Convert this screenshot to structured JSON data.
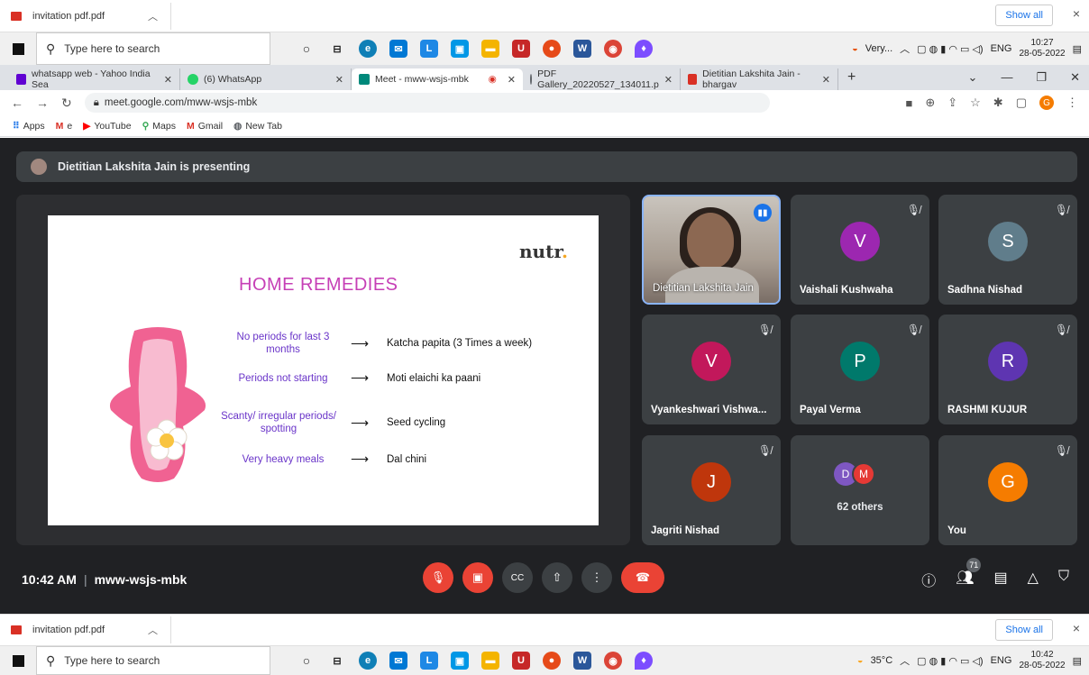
{
  "download_bar": {
    "file": "invitation pdf.pdf",
    "show_all": "Show all",
    "close": "×"
  },
  "taskbar_top": {
    "search_placeholder": "Type here to search",
    "weather": "Very...",
    "lang": "ENG",
    "time": "10:27",
    "date": "28-05-2022"
  },
  "tabs": [
    {
      "label": "whatsapp web - Yahoo India Sea",
      "color": "#6001d2"
    },
    {
      "label": "(6) WhatsApp",
      "color": "#25d366"
    },
    {
      "label": "Meet - mww-wsjs-mbk",
      "color": "#00897b"
    },
    {
      "label": "PDF Gallery_20220527_134011.p",
      "color": "#5f6368"
    },
    {
      "label": "Dietitian Lakshita Jain - bhargav",
      "color": "#d93025"
    }
  ],
  "address": {
    "url": "meet.google.com/mww-wsjs-mbk",
    "profile": "G"
  },
  "bookmarks": [
    "Apps",
    "e",
    "YouTube",
    "Maps",
    "Gmail",
    "New Tab"
  ],
  "meet": {
    "presenting": "Dietitian Lakshita Jain is presenting",
    "slide": {
      "brand": "nutr",
      "brand_dot": ".",
      "title": "HOME REMEDIES",
      "rows": [
        {
          "problem": "No periods for last 3 months",
          "remedy": "Katcha papita (3 Times a week)"
        },
        {
          "problem": "Periods not starting",
          "remedy": "Moti elaichi  ka paani"
        },
        {
          "problem": "Scanty/ irregular periods/ spotting",
          "remedy": "Seed cycling"
        },
        {
          "problem": "Very heavy meals",
          "remedy": "Dal chini"
        }
      ]
    },
    "participants": [
      {
        "name": "Dietitian Lakshita Jain",
        "initial": "",
        "color": ""
      },
      {
        "name": "Vaishali Kushwaha",
        "initial": "V",
        "color": "#9c27b0"
      },
      {
        "name": "Sadhna Nishad",
        "initial": "S",
        "color": "#607d8b"
      },
      {
        "name": "Vyankeshwari Vishwa...",
        "initial": "V",
        "color": "#c2185b"
      },
      {
        "name": "Payal Verma",
        "initial": "P",
        "color": "#00796b"
      },
      {
        "name": "RASHMI KUJUR",
        "initial": "R",
        "color": "#5e35b1"
      },
      {
        "name": "Jagriti Nishad",
        "initial": "J",
        "color": "#bf360c"
      },
      {
        "name": "",
        "initial": "",
        "color": ""
      },
      {
        "name": "You",
        "initial": "G",
        "color": "#f57c00"
      }
    ],
    "others": {
      "a": "D",
      "b": "M",
      "a_color": "#7e57c2",
      "b_color": "#e53935",
      "label": "62 others"
    },
    "time": "10:42 AM",
    "code": "mww-wsjs-mbk",
    "people_count": "71"
  },
  "taskbar_bottom": {
    "search_placeholder": "Type here to search",
    "weather": "35°C",
    "lang": "ENG",
    "time": "10:42",
    "date": "28-05-2022"
  }
}
